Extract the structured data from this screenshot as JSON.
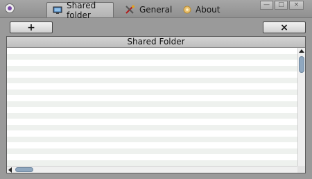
{
  "titlebar": {
    "tabs": [
      {
        "label": "Shared folder",
        "icon": "monitor-icon",
        "active": true
      },
      {
        "label": "General",
        "icon": "tools-icon",
        "active": false
      },
      {
        "label": "About",
        "icon": "info-icon",
        "active": false
      }
    ],
    "window_buttons": {
      "minimize": "—",
      "maximize": "□",
      "close": "×"
    }
  },
  "toolbar": {
    "add_label": "+",
    "remove_label": "×"
  },
  "table": {
    "column_header": "Shared Folder",
    "rows": []
  },
  "colors": {
    "active_tab": "#c0c0c0",
    "scroll_thumb": "#8fa7bf",
    "row_stripe": "#eef1ee"
  }
}
